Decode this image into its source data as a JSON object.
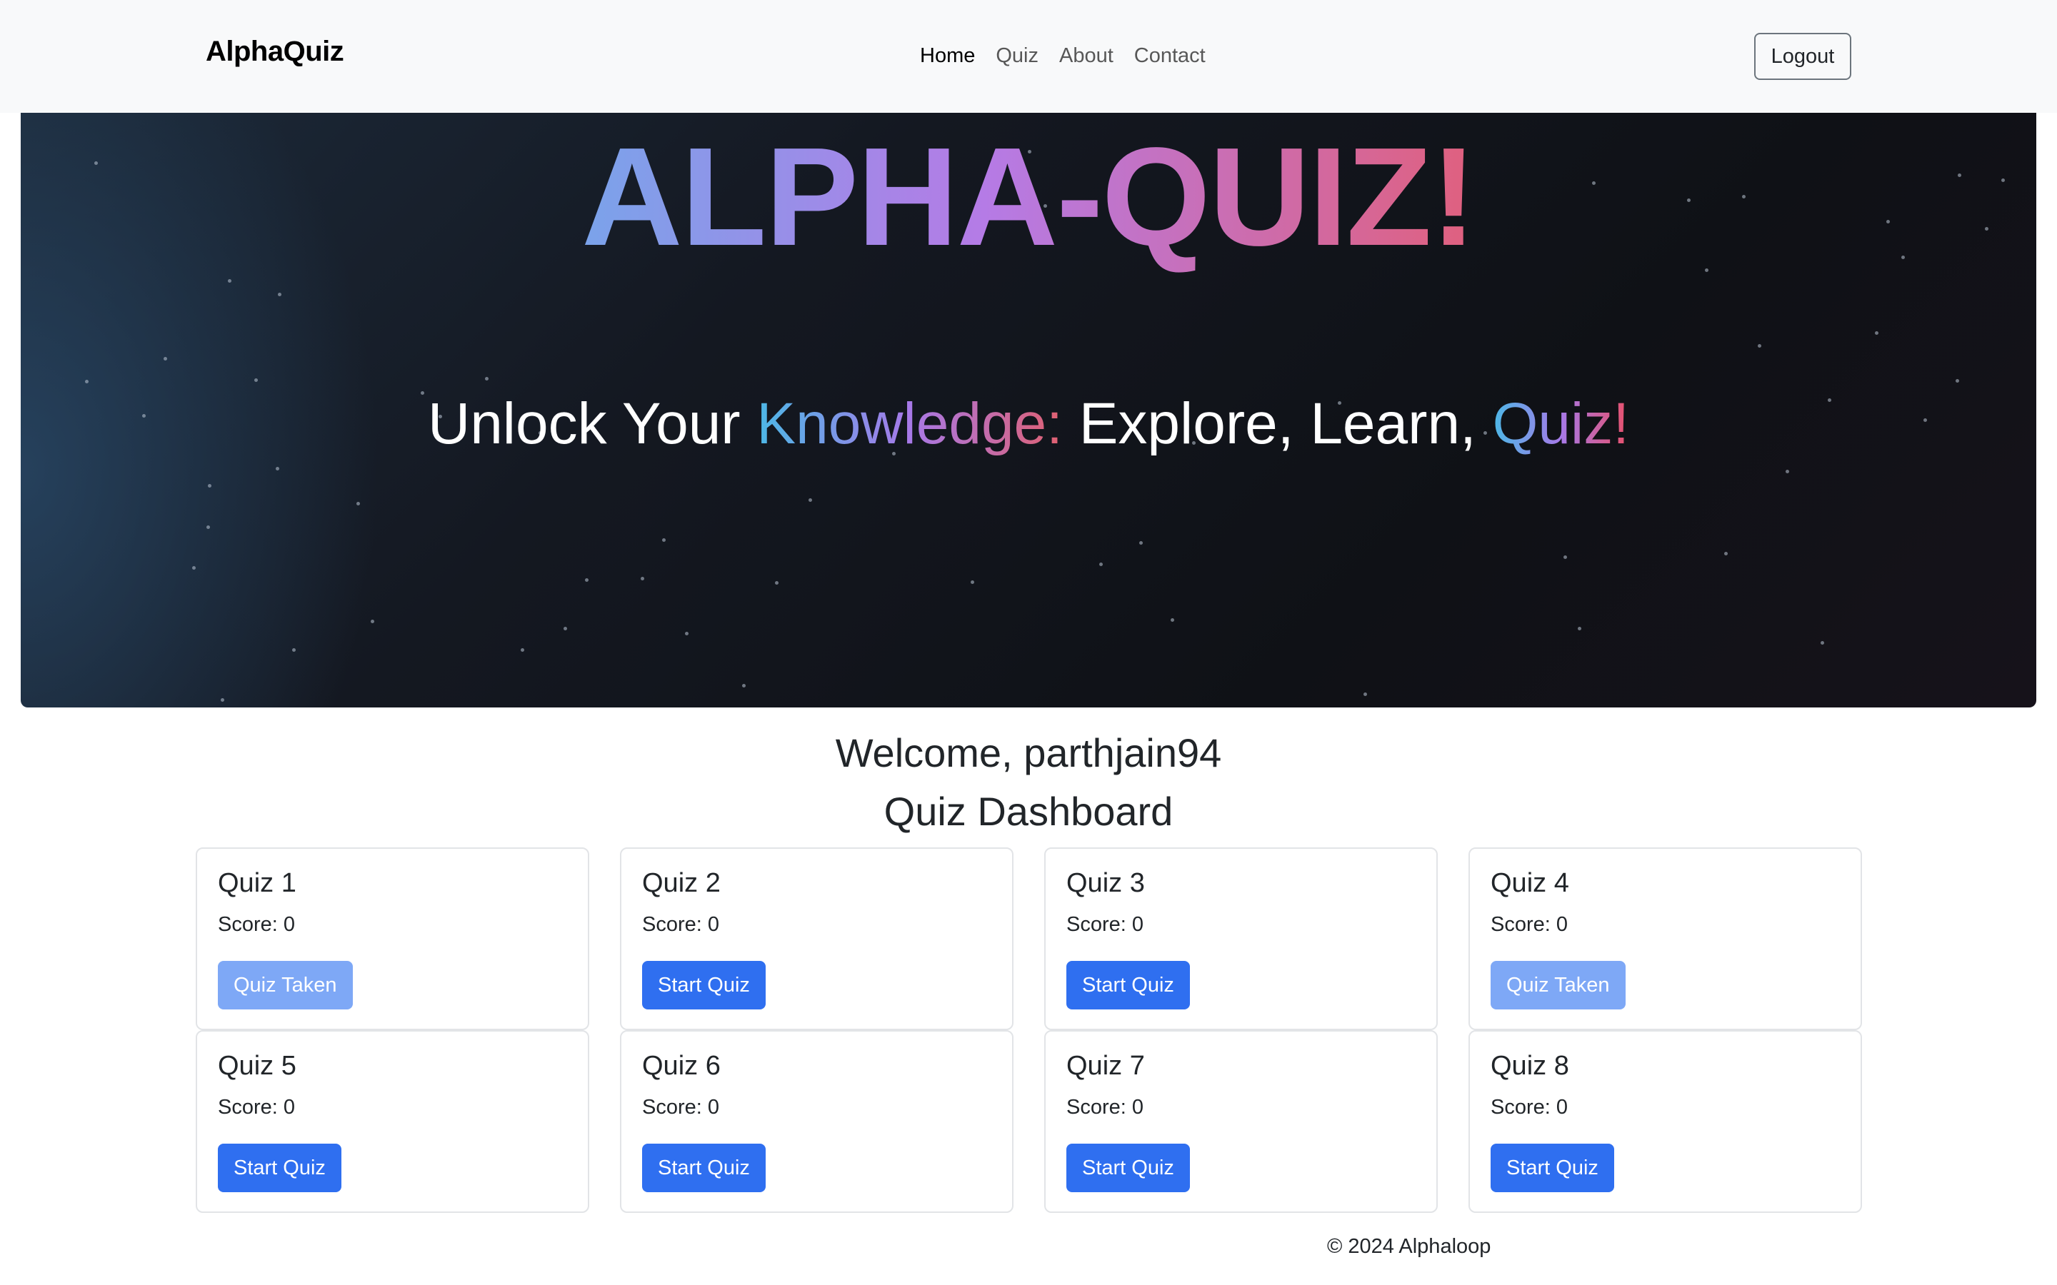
{
  "navbar": {
    "brand": "AlphaQuiz",
    "links": [
      "Home",
      "Quiz",
      "About",
      "Contact"
    ],
    "active_link": "Home",
    "logout_label": "Logout"
  },
  "hero": {
    "title": "ALPHA-QUIZ!",
    "subtitle_part1": "Unlock Your ",
    "subtitle_part2": "Knowledge:",
    "subtitle_part3": " Explore, Learn, ",
    "subtitle_part4": "Quiz!"
  },
  "welcome_text": "Welcome, parthjain94",
  "dashboard_title": "Quiz Dashboard",
  "quizzes": [
    {
      "title": "Quiz 1",
      "score": "Score: 0",
      "button": "Quiz Taken",
      "taken": true
    },
    {
      "title": "Quiz 2",
      "score": "Score: 0",
      "button": "Start Quiz",
      "taken": false
    },
    {
      "title": "Quiz 3",
      "score": "Score: 0",
      "button": "Start Quiz",
      "taken": false
    },
    {
      "title": "Quiz 4",
      "score": "Score: 0",
      "button": "Quiz Taken",
      "taken": true
    },
    {
      "title": "Quiz 5",
      "score": "Score: 0",
      "button": "Start Quiz",
      "taken": false
    },
    {
      "title": "Quiz 6",
      "score": "Score: 0",
      "button": "Start Quiz",
      "taken": false
    },
    {
      "title": "Quiz 7",
      "score": "Score: 0",
      "button": "Start Quiz",
      "taken": false
    },
    {
      "title": "Quiz 8",
      "score": "Score: 0",
      "button": "Start Quiz",
      "taken": false
    }
  ],
  "footer": "© 2024 Alphaloop",
  "colors": {
    "primary_button": "#2f6ff0",
    "taken_button": "#7ea8f6",
    "navbar_bg": "#f8f9fa"
  }
}
